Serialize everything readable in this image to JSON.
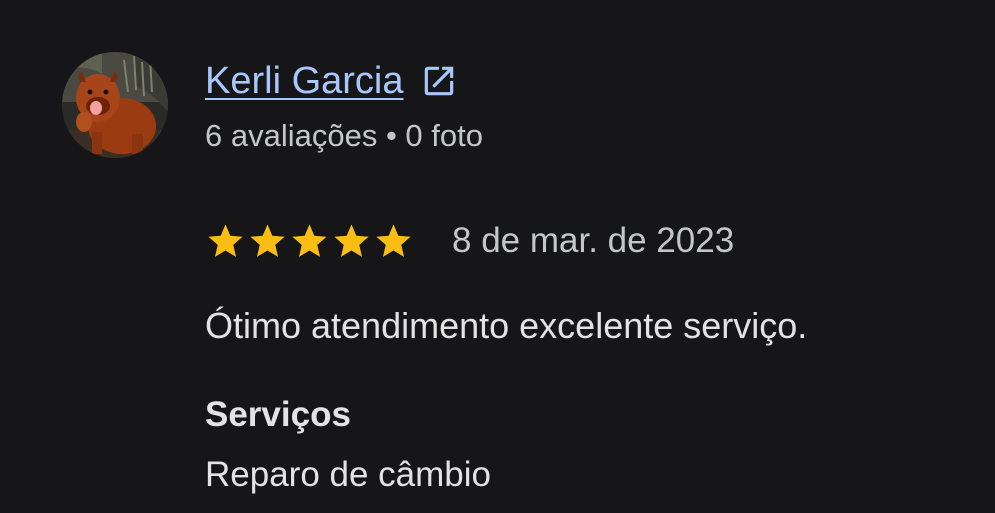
{
  "review": {
    "author": {
      "name": "Kerli Garcia",
      "meta": "6 avaliações • 0 foto",
      "avatar_icon": "dog-avatar-photo",
      "external_link_icon": "open-in-new-icon",
      "name_color": "#a8c7fa"
    },
    "rating": {
      "value": 5,
      "max": 5,
      "star_color": "#f9bd13",
      "date": "8 de mar. de 2023"
    },
    "text": "Ótimo atendimento excelente serviço.",
    "services": {
      "heading": "Serviços",
      "value": "Reparo de câmbio"
    }
  },
  "theme": {
    "background": "#161618",
    "text_primary": "#e3e3e3",
    "text_secondary": "#c4c7c5"
  }
}
